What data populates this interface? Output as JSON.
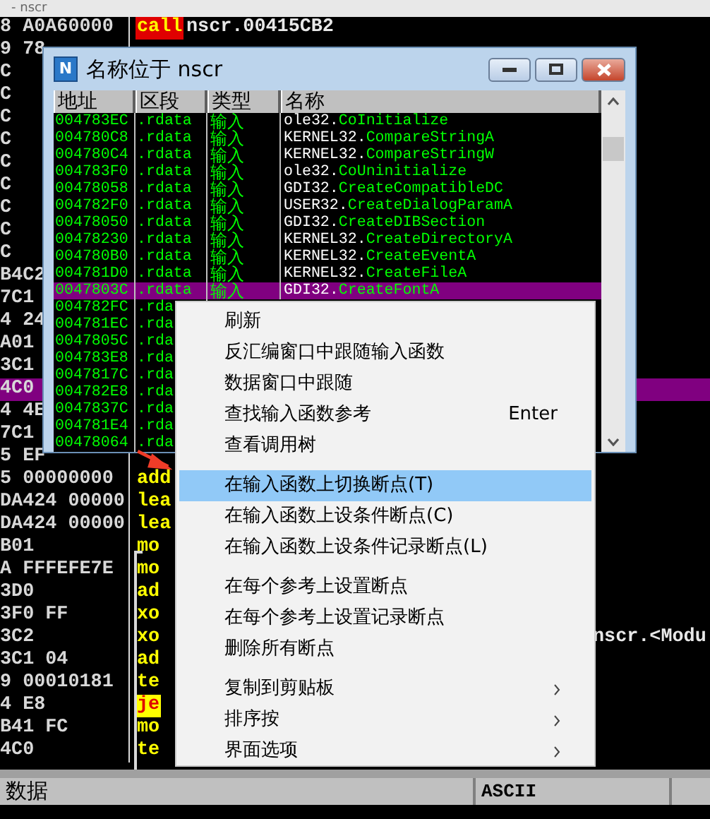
{
  "main_title": "- nscr",
  "disasm": {
    "rows": [
      {
        "address": "8 A0A60000",
        "mnemonic": "call",
        "kind": "call",
        "operand": "nscr.00415CB2",
        "selected": false
      },
      {
        "address": "9 78",
        "selected": false
      },
      {
        "address": "C",
        "selected": false
      },
      {
        "address": "C",
        "selected": false
      },
      {
        "address": "C",
        "selected": false
      },
      {
        "address": "C",
        "selected": false
      },
      {
        "address": "C",
        "selected": false
      },
      {
        "address": "C",
        "selected": false
      },
      {
        "address": "C",
        "selected": false
      },
      {
        "address": "C",
        "selected": false
      },
      {
        "address": "C",
        "selected": false
      },
      {
        "address": "B4C2",
        "selected": false
      },
      {
        "address": "7C1",
        "selected": false
      },
      {
        "address": "4 24",
        "selected": false
      },
      {
        "address": "A01",
        "selected": false
      },
      {
        "address": "3C1",
        "selected": false
      },
      {
        "address": "4C0",
        "selected": true
      },
      {
        "address": "4 4E",
        "selected": false
      },
      {
        "address": "7C1",
        "selected": false
      },
      {
        "address": "5 EF",
        "selected": false
      },
      {
        "address": "5 00000000",
        "mnemonic": "add",
        "kind": "normal",
        "selected": false
      },
      {
        "address": "DA424 00000",
        "mnemonic": "lea",
        "kind": "normal",
        "selected": false
      },
      {
        "address": "DA424 00000",
        "mnemonic": "lea",
        "kind": "normal",
        "selected": false
      },
      {
        "address": "B01",
        "mnemonic": "mo",
        "kind": "normal",
        "selected": false
      },
      {
        "address": "A FFFEFE7E",
        "mnemonic": "mo",
        "kind": "normal",
        "selected": false
      },
      {
        "address": "3D0",
        "mnemonic": "ad",
        "kind": "normal",
        "selected": false
      },
      {
        "address": "3F0 FF",
        "mnemonic": "xo",
        "kind": "normal",
        "selected": false
      },
      {
        "address": "3C2",
        "mnemonic": "xo",
        "kind": "normal",
        "comment": "nscr.<Modu",
        "selected": false
      },
      {
        "address": "3C1 04",
        "mnemonic": "ad",
        "kind": "normal",
        "selected": false
      },
      {
        "address": "9 00010181",
        "mnemonic": "te",
        "kind": "normal",
        "selected": false
      },
      {
        "address": "4 E8",
        "mnemonic": "je",
        "kind": "jump",
        "selected": false
      },
      {
        "address": "B41 FC",
        "mnemonic": "mo",
        "kind": "normal",
        "selected": false
      },
      {
        "address": "4C0",
        "mnemonic": "te",
        "kind": "normal",
        "selected": false
      }
    ]
  },
  "dialog": {
    "icon_letter": "N",
    "title": "名称位于 nscr",
    "columns": [
      "地址",
      "区段",
      "类型",
      "名称"
    ],
    "rows": [
      {
        "address": "004783EC",
        "section": ".rdata",
        "type": "输入",
        "module": "ole32.",
        "function": "CoInitialize",
        "selected": false
      },
      {
        "address": "004780C8",
        "section": ".rdata",
        "type": "输入",
        "module": "KERNEL32.",
        "function": "CompareStringA",
        "selected": false
      },
      {
        "address": "004780C4",
        "section": ".rdata",
        "type": "输入",
        "module": "KERNEL32.",
        "function": "CompareStringW",
        "selected": false
      },
      {
        "address": "004783F0",
        "section": ".rdata",
        "type": "输入",
        "module": "ole32.",
        "function": "CoUninitialize",
        "selected": false
      },
      {
        "address": "00478058",
        "section": ".rdata",
        "type": "输入",
        "module": "GDI32.",
        "function": "CreateCompatibleDC",
        "selected": false
      },
      {
        "address": "004782F0",
        "section": ".rdata",
        "type": "输入",
        "module": "USER32.",
        "function": "CreateDialogParamA",
        "selected": false
      },
      {
        "address": "00478050",
        "section": ".rdata",
        "type": "输入",
        "module": "GDI32.",
        "function": "CreateDIBSection",
        "selected": false
      },
      {
        "address": "00478230",
        "section": ".rdata",
        "type": "输入",
        "module": "KERNEL32.",
        "function": "CreateDirectoryA",
        "selected": false
      },
      {
        "address": "004780B0",
        "section": ".rdata",
        "type": "输入",
        "module": "KERNEL32.",
        "function": "CreateEventA",
        "selected": false
      },
      {
        "address": "004781D0",
        "section": ".rdata",
        "type": "输入",
        "module": "KERNEL32.",
        "function": "CreateFileA",
        "selected": false
      },
      {
        "address": "0047803C",
        "section": ".rdata",
        "type": "输入",
        "module": "GDI32.",
        "function": "CreateFontA",
        "selected": true
      },
      {
        "address": "004782FC",
        "section": ".rda",
        "selected": false
      },
      {
        "address": "004781EC",
        "section": ".rda",
        "selected": false
      },
      {
        "address": "0047805C",
        "section": ".rda",
        "selected": false
      },
      {
        "address": "004783E8",
        "section": ".rda",
        "selected": false
      },
      {
        "address": "0047817C",
        "section": ".rda",
        "selected": false
      },
      {
        "address": "004782E8",
        "section": ".rda",
        "selected": false
      },
      {
        "address": "0047837C",
        "section": ".rda",
        "selected": false
      },
      {
        "address": "004781E4",
        "section": ".rda",
        "selected": false
      },
      {
        "address": "00478064",
        "section": ".rda",
        "selected": false
      }
    ]
  },
  "context_menu": {
    "items": [
      {
        "kind": "item",
        "label": "刷新",
        "selected": false
      },
      {
        "kind": "item",
        "label": "反汇编窗口中跟随输入函数",
        "selected": false
      },
      {
        "kind": "item",
        "label": "数据窗口中跟随",
        "selected": false
      },
      {
        "kind": "item",
        "label": "查找输入函数参考",
        "shortcut": "Enter",
        "selected": false
      },
      {
        "kind": "item",
        "label": "查看调用树",
        "selected": false
      },
      {
        "kind": "separator"
      },
      {
        "kind": "item",
        "label": "在输入函数上切换断点(T)",
        "selected": true
      },
      {
        "kind": "item",
        "label": "在输入函数上设条件断点(C)",
        "selected": false
      },
      {
        "kind": "item",
        "label": "在输入函数上设条件记录断点(L)",
        "selected": false
      },
      {
        "kind": "separator"
      },
      {
        "kind": "item",
        "label": "在每个参考上设置断点",
        "selected": false
      },
      {
        "kind": "item",
        "label": "在每个参考上设置记录断点",
        "selected": false
      },
      {
        "kind": "item",
        "label": "删除所有断点",
        "selected": false
      },
      {
        "kind": "separator"
      },
      {
        "kind": "submenu",
        "label": "复制到剪贴板",
        "selected": false
      },
      {
        "kind": "submenu",
        "label": "排序按",
        "selected": false
      },
      {
        "kind": "submenu",
        "label": "界面选项",
        "selected": false
      }
    ]
  },
  "dump": {
    "columns": [
      "数据",
      "ASCII"
    ]
  }
}
